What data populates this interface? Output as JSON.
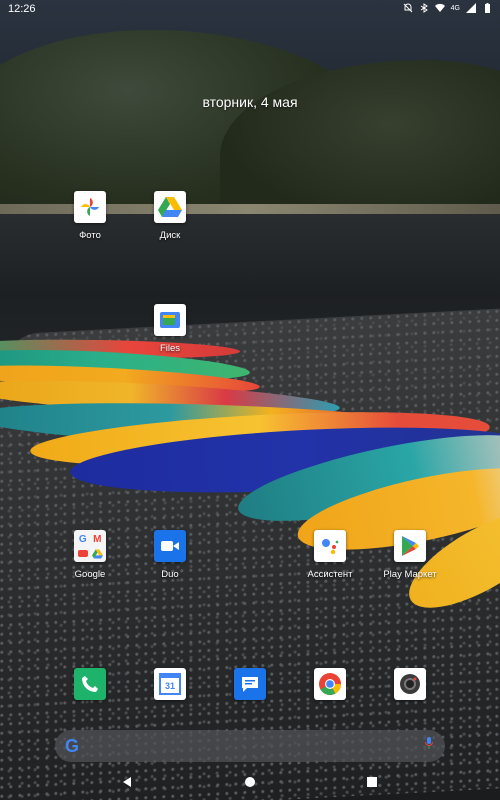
{
  "status_bar": {
    "time": "12:26",
    "icons": [
      "dnd-off-icon",
      "bluetooth-icon",
      "wifi-icon",
      "signal-icon",
      "battery-icon"
    ],
    "network_label": "4G"
  },
  "date": "вторник, 4 мая",
  "apps": [
    {
      "label": "Фото",
      "icon": "google-photos-icon"
    },
    {
      "label": "Диск",
      "icon": "google-drive-icon"
    },
    {
      "label": "Files",
      "icon": "files-icon"
    },
    {
      "label": "Google",
      "icon": "google-folder-icon"
    },
    {
      "label": "Duo",
      "icon": "duo-icon"
    },
    {
      "label": "Ассистент",
      "icon": "assistant-icon"
    },
    {
      "label": "Play Маркет",
      "icon": "play-store-icon"
    }
  ],
  "dock": [
    {
      "icon": "phone-icon"
    },
    {
      "icon": "calendar-icon",
      "text": "31"
    },
    {
      "icon": "messages-icon"
    },
    {
      "icon": "chrome-icon"
    },
    {
      "icon": "camera-icon"
    }
  ],
  "search": {
    "logo": "G"
  },
  "colors": {
    "google_blue": "#4285F4",
    "google_red": "#EA4335",
    "google_yellow": "#FBBC05",
    "google_green": "#34A853"
  }
}
